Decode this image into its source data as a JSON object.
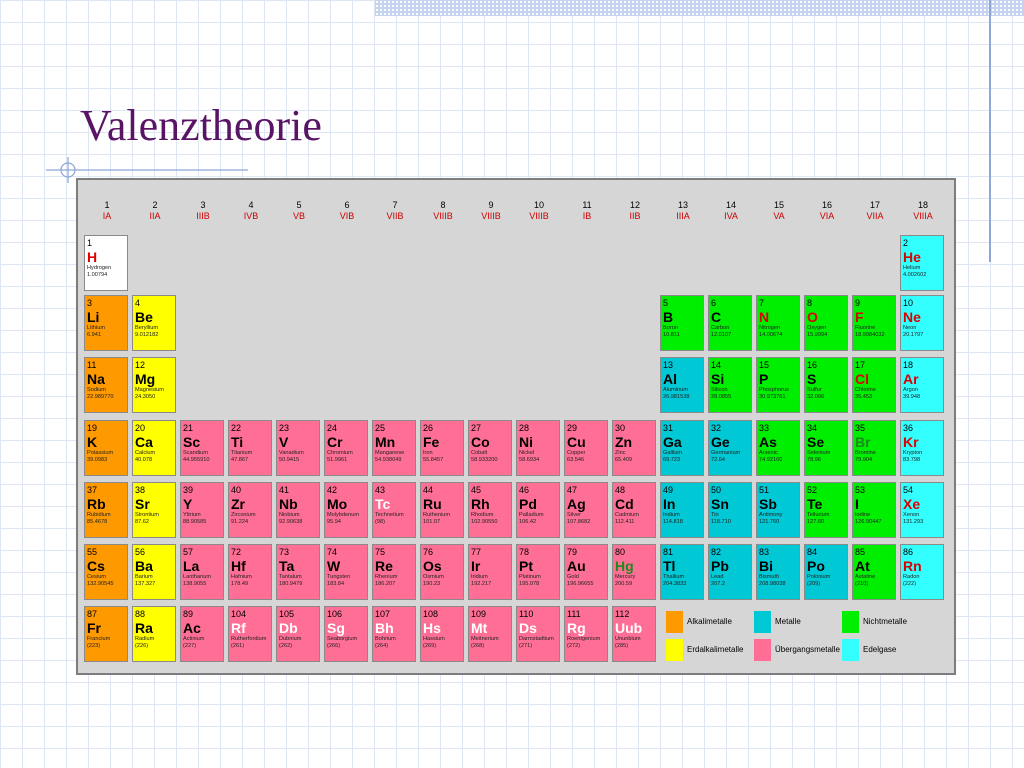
{
  "title": "Valenztheorie",
  "groups": [
    {
      "num": "1",
      "roman": "IA"
    },
    {
      "num": "2",
      "roman": "IIA"
    },
    {
      "num": "3",
      "roman": "IIIB"
    },
    {
      "num": "4",
      "roman": "IVB"
    },
    {
      "num": "5",
      "roman": "VB"
    },
    {
      "num": "6",
      "roman": "VIB"
    },
    {
      "num": "7",
      "roman": "VIIB"
    },
    {
      "num": "8",
      "roman": "VIIIB"
    },
    {
      "num": "9",
      "roman": "VIIIB"
    },
    {
      "num": "10",
      "roman": "VIIIB"
    },
    {
      "num": "11",
      "roman": "IB"
    },
    {
      "num": "12",
      "roman": "IIB"
    },
    {
      "num": "13",
      "roman": "IIIA"
    },
    {
      "num": "14",
      "roman": "IVA"
    },
    {
      "num": "15",
      "roman": "VA"
    },
    {
      "num": "16",
      "roman": "VIA"
    },
    {
      "num": "17",
      "roman": "VIIA"
    },
    {
      "num": "18",
      "roman": "VIIIA"
    }
  ],
  "elements": [
    {
      "z": "1",
      "sym": "H",
      "name": "Hydrogen",
      "mass": "1.00794",
      "cat": "hyd",
      "state": "gas",
      "row": 1,
      "col": 1
    },
    {
      "z": "2",
      "sym": "He",
      "name": "Helium",
      "mass": "4.002602",
      "cat": "noble",
      "state": "gas",
      "row": 1,
      "col": 18
    },
    {
      "z": "3",
      "sym": "Li",
      "name": "Lithium",
      "mass": "6.941",
      "cat": "alkali",
      "row": 2,
      "col": 1
    },
    {
      "z": "4",
      "sym": "Be",
      "name": "Beryllium",
      "mass": "9.012182",
      "cat": "earth",
      "row": 2,
      "col": 2
    },
    {
      "z": "5",
      "sym": "B",
      "name": "Boron",
      "mass": "10.811",
      "cat": "nonmetal",
      "row": 2,
      "col": 13
    },
    {
      "z": "6",
      "sym": "C",
      "name": "Carbon",
      "mass": "12.0107",
      "cat": "nonmetal",
      "row": 2,
      "col": 14
    },
    {
      "z": "7",
      "sym": "N",
      "name": "Nitrogen",
      "mass": "14.00674",
      "cat": "nonmetal",
      "state": "gas",
      "row": 2,
      "col": 15
    },
    {
      "z": "8",
      "sym": "O",
      "name": "Oxygen",
      "mass": "15.9994",
      "cat": "nonmetal",
      "state": "gas",
      "row": 2,
      "col": 16
    },
    {
      "z": "9",
      "sym": "F",
      "name": "Fluorine",
      "mass": "18.9984032",
      "cat": "nonmetal",
      "state": "gas",
      "row": 2,
      "col": 17
    },
    {
      "z": "10",
      "sym": "Ne",
      "name": "Neon",
      "mass": "20.1797",
      "cat": "noble",
      "state": "gas",
      "row": 2,
      "col": 18
    },
    {
      "z": "11",
      "sym": "Na",
      "name": "Sodium",
      "mass": "22.989770",
      "cat": "alkali",
      "row": 3,
      "col": 1
    },
    {
      "z": "12",
      "sym": "Mg",
      "name": "Magnesium",
      "mass": "24.3050",
      "cat": "earth",
      "row": 3,
      "col": 2
    },
    {
      "z": "13",
      "sym": "Al",
      "name": "Aluminum",
      "mass": "26.981538",
      "cat": "metal",
      "row": 3,
      "col": 13
    },
    {
      "z": "14",
      "sym": "Si",
      "name": "Silicon",
      "mass": "28.0855",
      "cat": "nonmetal",
      "row": 3,
      "col": 14
    },
    {
      "z": "15",
      "sym": "P",
      "name": "Phosphorus",
      "mass": "30.973761",
      "cat": "nonmetal",
      "row": 3,
      "col": 15
    },
    {
      "z": "16",
      "sym": "S",
      "name": "Sulfur",
      "mass": "32.066",
      "cat": "nonmetal",
      "row": 3,
      "col": 16
    },
    {
      "z": "17",
      "sym": "Cl",
      "name": "Chlorine",
      "mass": "35.453",
      "cat": "nonmetal",
      "state": "gas",
      "row": 3,
      "col": 17
    },
    {
      "z": "18",
      "sym": "Ar",
      "name": "Argon",
      "mass": "39.948",
      "cat": "noble",
      "state": "gas",
      "row": 3,
      "col": 18
    },
    {
      "z": "19",
      "sym": "K",
      "name": "Potassium",
      "mass": "39.0983",
      "cat": "alkali",
      "row": 4,
      "col": 1
    },
    {
      "z": "20",
      "sym": "Ca",
      "name": "Calcium",
      "mass": "40.078",
      "cat": "earth",
      "row": 4,
      "col": 2
    },
    {
      "z": "21",
      "sym": "Sc",
      "name": "Scandium",
      "mass": "44.955910",
      "cat": "trans",
      "row": 4,
      "col": 3
    },
    {
      "z": "22",
      "sym": "Ti",
      "name": "Titanium",
      "mass": "47.867",
      "cat": "trans",
      "row": 4,
      "col": 4
    },
    {
      "z": "23",
      "sym": "V",
      "name": "Vanadium",
      "mass": "50.9415",
      "cat": "trans",
      "row": 4,
      "col": 5
    },
    {
      "z": "24",
      "sym": "Cr",
      "name": "Chromium",
      "mass": "51.9961",
      "cat": "trans",
      "row": 4,
      "col": 6
    },
    {
      "z": "25",
      "sym": "Mn",
      "name": "Manganese",
      "mass": "54.938049",
      "cat": "trans",
      "row": 4,
      "col": 7
    },
    {
      "z": "26",
      "sym": "Fe",
      "name": "Iron",
      "mass": "55.8457",
      "cat": "trans",
      "row": 4,
      "col": 8
    },
    {
      "z": "27",
      "sym": "Co",
      "name": "Cobalt",
      "mass": "58.933200",
      "cat": "trans",
      "row": 4,
      "col": 9
    },
    {
      "z": "28",
      "sym": "Ni",
      "name": "Nickel",
      "mass": "58.6934",
      "cat": "trans",
      "row": 4,
      "col": 10
    },
    {
      "z": "29",
      "sym": "Cu",
      "name": "Copper",
      "mass": "63.546",
      "cat": "trans",
      "row": 4,
      "col": 11
    },
    {
      "z": "30",
      "sym": "Zn",
      "name": "Zinc",
      "mass": "65.409",
      "cat": "trans",
      "row": 4,
      "col": 12
    },
    {
      "z": "31",
      "sym": "Ga",
      "name": "Gallium",
      "mass": "69.723",
      "cat": "metal",
      "row": 4,
      "col": 13
    },
    {
      "z": "32",
      "sym": "Ge",
      "name": "Germanium",
      "mass": "72.64",
      "cat": "metal",
      "row": 4,
      "col": 14
    },
    {
      "z": "33",
      "sym": "As",
      "name": "Arsenic",
      "mass": "74.92160",
      "cat": "nonmetal",
      "row": 4,
      "col": 15
    },
    {
      "z": "34",
      "sym": "Se",
      "name": "Selenium",
      "mass": "78.96",
      "cat": "nonmetal",
      "row": 4,
      "col": 16
    },
    {
      "z": "35",
      "sym": "Br",
      "name": "Bromine",
      "mass": "79.904",
      "cat": "nonmetal",
      "state": "liquid",
      "row": 4,
      "col": 17
    },
    {
      "z": "36",
      "sym": "Kr",
      "name": "Krypton",
      "mass": "83.798",
      "cat": "noble",
      "state": "gas",
      "row": 4,
      "col": 18
    },
    {
      "z": "37",
      "sym": "Rb",
      "name": "Rubidium",
      "mass": "85.4678",
      "cat": "alkali",
      "row": 5,
      "col": 1
    },
    {
      "z": "38",
      "sym": "Sr",
      "name": "Strontium",
      "mass": "87.62",
      "cat": "earth",
      "row": 5,
      "col": 2
    },
    {
      "z": "39",
      "sym": "Y",
      "name": "Yttrium",
      "mass": "88.90585",
      "cat": "trans",
      "row": 5,
      "col": 3
    },
    {
      "z": "40",
      "sym": "Zr",
      "name": "Zirconium",
      "mass": "91.224",
      "cat": "trans",
      "row": 5,
      "col": 4
    },
    {
      "z": "41",
      "sym": "Nb",
      "name": "Niobium",
      "mass": "92.90638",
      "cat": "trans",
      "row": 5,
      "col": 5
    },
    {
      "z": "42",
      "sym": "Mo",
      "name": "Molybdenum",
      "mass": "95.94",
      "cat": "trans",
      "row": 5,
      "col": 6
    },
    {
      "z": "43",
      "sym": "Tc",
      "name": "Technetium",
      "mass": "(98)",
      "cat": "trans",
      "state": "synth",
      "row": 5,
      "col": 7
    },
    {
      "z": "44",
      "sym": "Ru",
      "name": "Ruthenium",
      "mass": "101.07",
      "cat": "trans",
      "row": 5,
      "col": 8
    },
    {
      "z": "45",
      "sym": "Rh",
      "name": "Rhodium",
      "mass": "102.90550",
      "cat": "trans",
      "row": 5,
      "col": 9
    },
    {
      "z": "46",
      "sym": "Pd",
      "name": "Palladium",
      "mass": "106.42",
      "cat": "trans",
      "row": 5,
      "col": 10
    },
    {
      "z": "47",
      "sym": "Ag",
      "name": "Silver",
      "mass": "107.8682",
      "cat": "trans",
      "row": 5,
      "col": 11
    },
    {
      "z": "48",
      "sym": "Cd",
      "name": "Cadmium",
      "mass": "112.411",
      "cat": "trans",
      "row": 5,
      "col": 12
    },
    {
      "z": "49",
      "sym": "In",
      "name": "Indium",
      "mass": "114.818",
      "cat": "metal",
      "row": 5,
      "col": 13
    },
    {
      "z": "50",
      "sym": "Sn",
      "name": "Tin",
      "mass": "118.710",
      "cat": "metal",
      "row": 5,
      "col": 14
    },
    {
      "z": "51",
      "sym": "Sb",
      "name": "Antimony",
      "mass": "121.760",
      "cat": "metal",
      "row": 5,
      "col": 15
    },
    {
      "z": "52",
      "sym": "Te",
      "name": "Tellurium",
      "mass": "127.60",
      "cat": "nonmetal",
      "row": 5,
      "col": 16
    },
    {
      "z": "53",
      "sym": "I",
      "name": "Iodine",
      "mass": "126.90447",
      "cat": "nonmetal",
      "row": 5,
      "col": 17
    },
    {
      "z": "54",
      "sym": "Xe",
      "name": "Xenon",
      "mass": "131.293",
      "cat": "noble",
      "state": "gas",
      "row": 5,
      "col": 18
    },
    {
      "z": "55",
      "sym": "Cs",
      "name": "Cesium",
      "mass": "132.90545",
      "cat": "alkali",
      "row": 6,
      "col": 1
    },
    {
      "z": "56",
      "sym": "Ba",
      "name": "Barium",
      "mass": "137.327",
      "cat": "earth",
      "row": 6,
      "col": 2
    },
    {
      "z": "57",
      "sym": "La",
      "name": "Lanthanum",
      "mass": "138.9055",
      "cat": "trans",
      "row": 6,
      "col": 3
    },
    {
      "z": "72",
      "sym": "Hf",
      "name": "Hafnium",
      "mass": "178.49",
      "cat": "trans",
      "row": 6,
      "col": 4
    },
    {
      "z": "73",
      "sym": "Ta",
      "name": "Tantalum",
      "mass": "180.9479",
      "cat": "trans",
      "row": 6,
      "col": 5
    },
    {
      "z": "74",
      "sym": "W",
      "name": "Tungsten",
      "mass": "183.84",
      "cat": "trans",
      "row": 6,
      "col": 6
    },
    {
      "z": "75",
      "sym": "Re",
      "name": "Rhenium",
      "mass": "186.207",
      "cat": "trans",
      "row": 6,
      "col": 7
    },
    {
      "z": "76",
      "sym": "Os",
      "name": "Osmium",
      "mass": "190.23",
      "cat": "trans",
      "row": 6,
      "col": 8
    },
    {
      "z": "77",
      "sym": "Ir",
      "name": "Iridium",
      "mass": "192.217",
      "cat": "trans",
      "row": 6,
      "col": 9
    },
    {
      "z": "78",
      "sym": "Pt",
      "name": "Platinum",
      "mass": "195.078",
      "cat": "trans",
      "row": 6,
      "col": 10
    },
    {
      "z": "79",
      "sym": "Au",
      "name": "Gold",
      "mass": "196.96655",
      "cat": "trans",
      "row": 6,
      "col": 11
    },
    {
      "z": "80",
      "sym": "Hg",
      "name": "Mercury",
      "mass": "200.59",
      "cat": "trans",
      "state": "liquid",
      "row": 6,
      "col": 12
    },
    {
      "z": "81",
      "sym": "Tl",
      "name": "Thallium",
      "mass": "204.3833",
      "cat": "metal",
      "row": 6,
      "col": 13
    },
    {
      "z": "82",
      "sym": "Pb",
      "name": "Lead",
      "mass": "207.2",
      "cat": "metal",
      "row": 6,
      "col": 14
    },
    {
      "z": "83",
      "sym": "Bi",
      "name": "Bismuth",
      "mass": "208.98038",
      "cat": "metal",
      "row": 6,
      "col": 15
    },
    {
      "z": "84",
      "sym": "Po",
      "name": "Polonium",
      "mass": "(209)",
      "cat": "metal",
      "row": 6,
      "col": 16
    },
    {
      "z": "85",
      "sym": "At",
      "name": "Astatine",
      "mass": "(210)",
      "cat": "nonmetal",
      "row": 6,
      "col": 17
    },
    {
      "z": "86",
      "sym": "Rn",
      "name": "Radon",
      "mass": "(222)",
      "cat": "noble",
      "state": "gas",
      "row": 6,
      "col": 18
    },
    {
      "z": "87",
      "sym": "Fr",
      "name": "Francium",
      "mass": "(223)",
      "cat": "alkali",
      "row": 7,
      "col": 1
    },
    {
      "z": "88",
      "sym": "Ra",
      "name": "Radium",
      "mass": "(226)",
      "cat": "earth",
      "row": 7,
      "col": 2
    },
    {
      "z": "89",
      "sym": "Ac",
      "name": "Actinium",
      "mass": "(227)",
      "cat": "trans",
      "row": 7,
      "col": 3
    },
    {
      "z": "104",
      "sym": "Rf",
      "name": "Rutherfordium",
      "mass": "(261)",
      "cat": "trans",
      "state": "synth",
      "row": 7,
      "col": 4
    },
    {
      "z": "105",
      "sym": "Db",
      "name": "Dubnium",
      "mass": "(262)",
      "cat": "trans",
      "state": "synth",
      "row": 7,
      "col": 5
    },
    {
      "z": "106",
      "sym": "Sg",
      "name": "Seaborgium",
      "mass": "(266)",
      "cat": "trans",
      "state": "synth",
      "row": 7,
      "col": 6
    },
    {
      "z": "107",
      "sym": "Bh",
      "name": "Bohrium",
      "mass": "(264)",
      "cat": "trans",
      "state": "synth",
      "row": 7,
      "col": 7
    },
    {
      "z": "108",
      "sym": "Hs",
      "name": "Hassium",
      "mass": "(269)",
      "cat": "trans",
      "state": "synth",
      "row": 7,
      "col": 8
    },
    {
      "z": "109",
      "sym": "Mt",
      "name": "Meitnerium",
      "mass": "(268)",
      "cat": "trans",
      "state": "synth",
      "row": 7,
      "col": 9
    },
    {
      "z": "110",
      "sym": "Ds",
      "name": "Darmstadtium",
      "mass": "(271)",
      "cat": "trans",
      "state": "synth",
      "row": 7,
      "col": 10
    },
    {
      "z": "111",
      "sym": "Rg",
      "name": "Roentgenium",
      "mass": "(272)",
      "cat": "trans",
      "state": "synth",
      "row": 7,
      "col": 11
    },
    {
      "z": "112",
      "sym": "Uub",
      "name": "Ununbium",
      "mass": "(285)",
      "cat": "trans",
      "state": "synth",
      "row": 7,
      "col": 12
    }
  ],
  "legend": [
    {
      "label": "Alkalimetalle",
      "color": "#ff9900"
    },
    {
      "label": "Metalle",
      "color": "#00c8d4"
    },
    {
      "label": "Nichtmetalle",
      "color": "#00ee00"
    },
    {
      "label": "Erdalkalimetalle",
      "color": "#ffff00"
    },
    {
      "label": "Übergangsmetalle",
      "color": "#ff6f95"
    },
    {
      "label": "Edelgase",
      "color": "#33ffff"
    }
  ]
}
